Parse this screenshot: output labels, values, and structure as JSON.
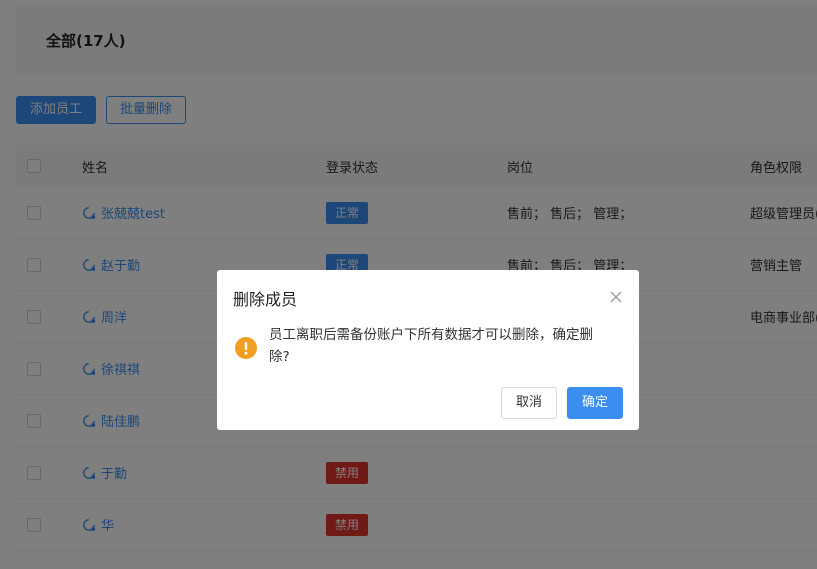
{
  "header": {
    "title": "全部(17人)"
  },
  "toolbar": {
    "add_label": "添加员工",
    "batch_delete_label": "批量删除"
  },
  "table": {
    "columns": [
      "姓名",
      "登录状态",
      "岗位",
      "角色权限"
    ],
    "rows": [
      {
        "name": "张兢兢test",
        "status": "正常",
        "position": "售前；  售后；  管理；",
        "role": "超级管理员("
      },
      {
        "name": "赵于勤",
        "status": "正常",
        "position": "售前；  售后；  管理；",
        "role": "营销主管"
      },
      {
        "name": "周洋",
        "status": "",
        "position": "",
        "role": "电商事业部("
      },
      {
        "name": "徐祺祺",
        "status": "",
        "position": "",
        "role": ""
      },
      {
        "name": "陆佳鹏",
        "status": "",
        "position": "",
        "role": ""
      },
      {
        "name": "于勤",
        "status": "禁用",
        "position": "",
        "role": ""
      },
      {
        "name": "华",
        "status": "禁用",
        "position": "",
        "role": ""
      }
    ]
  },
  "dialog": {
    "title": "删除成员",
    "message": "员工离职后需备份账户下所有数据才可以删除，确定删除？",
    "message_line1": "员工离职后需备份账户下所有数据才可以删除，确定删",
    "message_line2": "除?",
    "cancel_label": "取消",
    "confirm_label": "确定"
  },
  "colors": {
    "accent": "#3b8ef0",
    "danger": "#e0342d",
    "warning": "#f0a020"
  },
  "icons": {
    "user": "user-icon",
    "close": "close-icon",
    "warning": "warning-icon"
  }
}
